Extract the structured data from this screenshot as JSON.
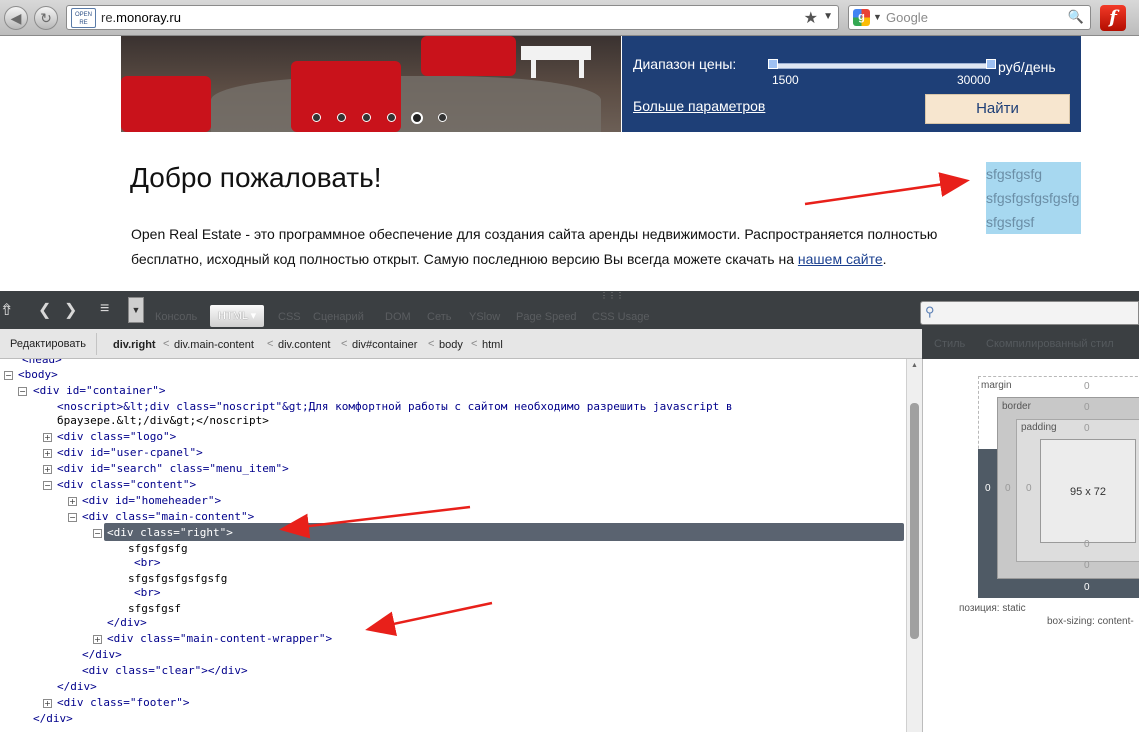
{
  "browser": {
    "site_icon_text_1": "OPEN",
    "site_icon_text_2": "RE",
    "url_prefix": "re.",
    "url_host": "monoray.ru",
    "search_placeholder": "Google"
  },
  "page": {
    "price_range_label": "Диапазон цены:",
    "price_min": "1500",
    "price_max": "30000",
    "price_unit": "руб/день",
    "more_params_link": "Больше параметров",
    "find_button": "Найти",
    "welcome_heading": "Добро пожаловать!",
    "intro_text_1": "Open Real Estate - это программное обеспечение для создания сайта аренды недвижимости. Распространяется полностью бесплатно, исходный код полностью открыт. Самую последнюю версию Вы всегда можете скачать на ",
    "intro_link": "нашем сайте",
    "intro_text_2": ".",
    "right_box_lines": [
      "sfgsfgsfg",
      "sfgsfgsfgsfgsfg",
      "sfgsfgsf"
    ],
    "slider_dots": 6,
    "slider_active_dot": 5
  },
  "devtools": {
    "tabs": [
      "Консоль",
      "HTML",
      "CSS",
      "Сценарий",
      "DOM",
      "Сеть",
      "YSlow",
      "Page Speed",
      "CSS Usage"
    ],
    "active_tab": "HTML",
    "edit_button": "Редактировать",
    "breadcrumbs": [
      "div.right",
      "div.main-content",
      "div.content",
      "div#container",
      "body",
      "html"
    ],
    "side_tabs": [
      "Стиль",
      "Скомпилированный стил"
    ],
    "layout": {
      "margin_label": "margin",
      "border_label": "border",
      "padding_label": "padding",
      "content_size": "95 x 72",
      "zero": "0",
      "position_label": "позиция: static",
      "box_sizing_label": "box-sizing: content-"
    },
    "tree": {
      "head": "<head>",
      "body_open": "<body>",
      "container_open": "<div id=\"container\">",
      "noscript_1": "<noscript>&lt;div class=\"noscript\"&gt;Для комфортной работы с сайтом необходимо разрешить javascript в",
      "noscript_2": "браузере.&lt;/div&gt;</noscript>",
      "logo": "<div class=\"logo\">",
      "user_cpanel": "<div id=\"user-cpanel\">",
      "search": "<div id=\"search\" class=\"menu_item\">",
      "content_open": "<div class=\"content\">",
      "homeheader": "<div id=\"homeheader\">",
      "main_content_open": "<div class=\"main-content\">",
      "right_open": "<div class=\"right\">",
      "txt1": "sfgsfgsfg",
      "br1": "<br>",
      "txt2": "sfgsfgsfgsfgsfg",
      "br2": "<br>",
      "txt3": "sfgsfgsf",
      "close_div_1": "</div>",
      "wrapper": "<div class=\"main-content-wrapper\">",
      "close_div_2": "</div>",
      "clear": "<div class=\"clear\"></div>",
      "close_div_3": "</div>",
      "footer": "<div class=\"footer\">",
      "close_div_4": "</div>"
    }
  }
}
